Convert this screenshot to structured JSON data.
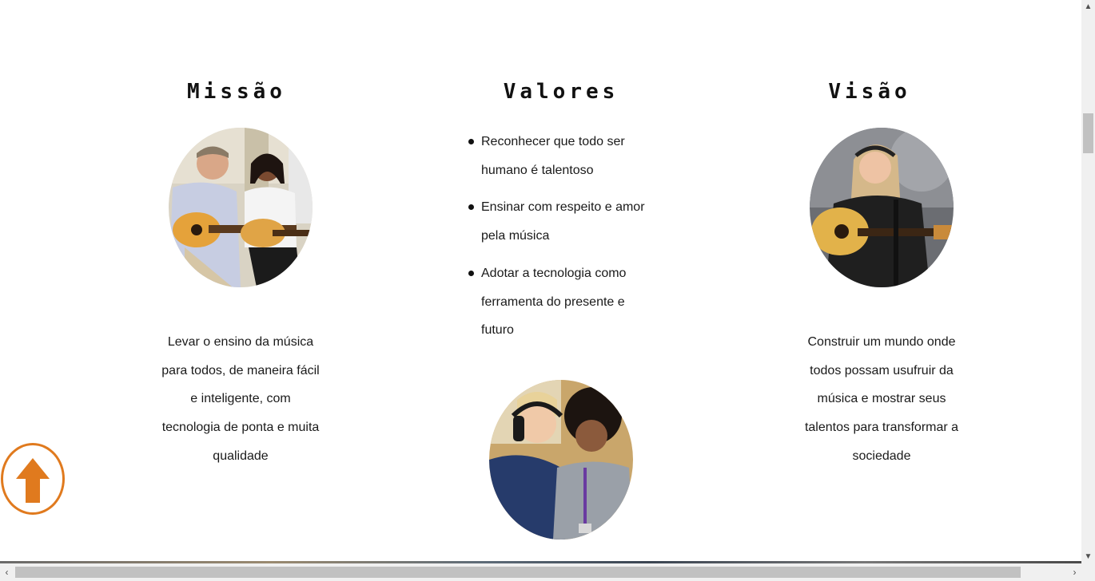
{
  "missao": {
    "title": "Missão",
    "text": "Levar o ensino da música para todos, de maneira fácil e inteligente, com tecnologia de ponta e muita qualidade"
  },
  "valores": {
    "title": "Valores",
    "items": [
      "Reconhecer que todo ser humano é talentoso",
      "Ensinar com respeito e amor pela música",
      "Adotar a tecnologia como ferramenta do presente e futuro"
    ]
  },
  "visao": {
    "title": "Visão",
    "text": "Construir um mundo onde todos possam usufruir da música e mostrar seus talentos para transformar a sociedade"
  },
  "colors": {
    "accent": "#e07a1e",
    "text": "#1a1a1a"
  },
  "icons": {
    "back_to_top": "arrow-up-icon"
  }
}
